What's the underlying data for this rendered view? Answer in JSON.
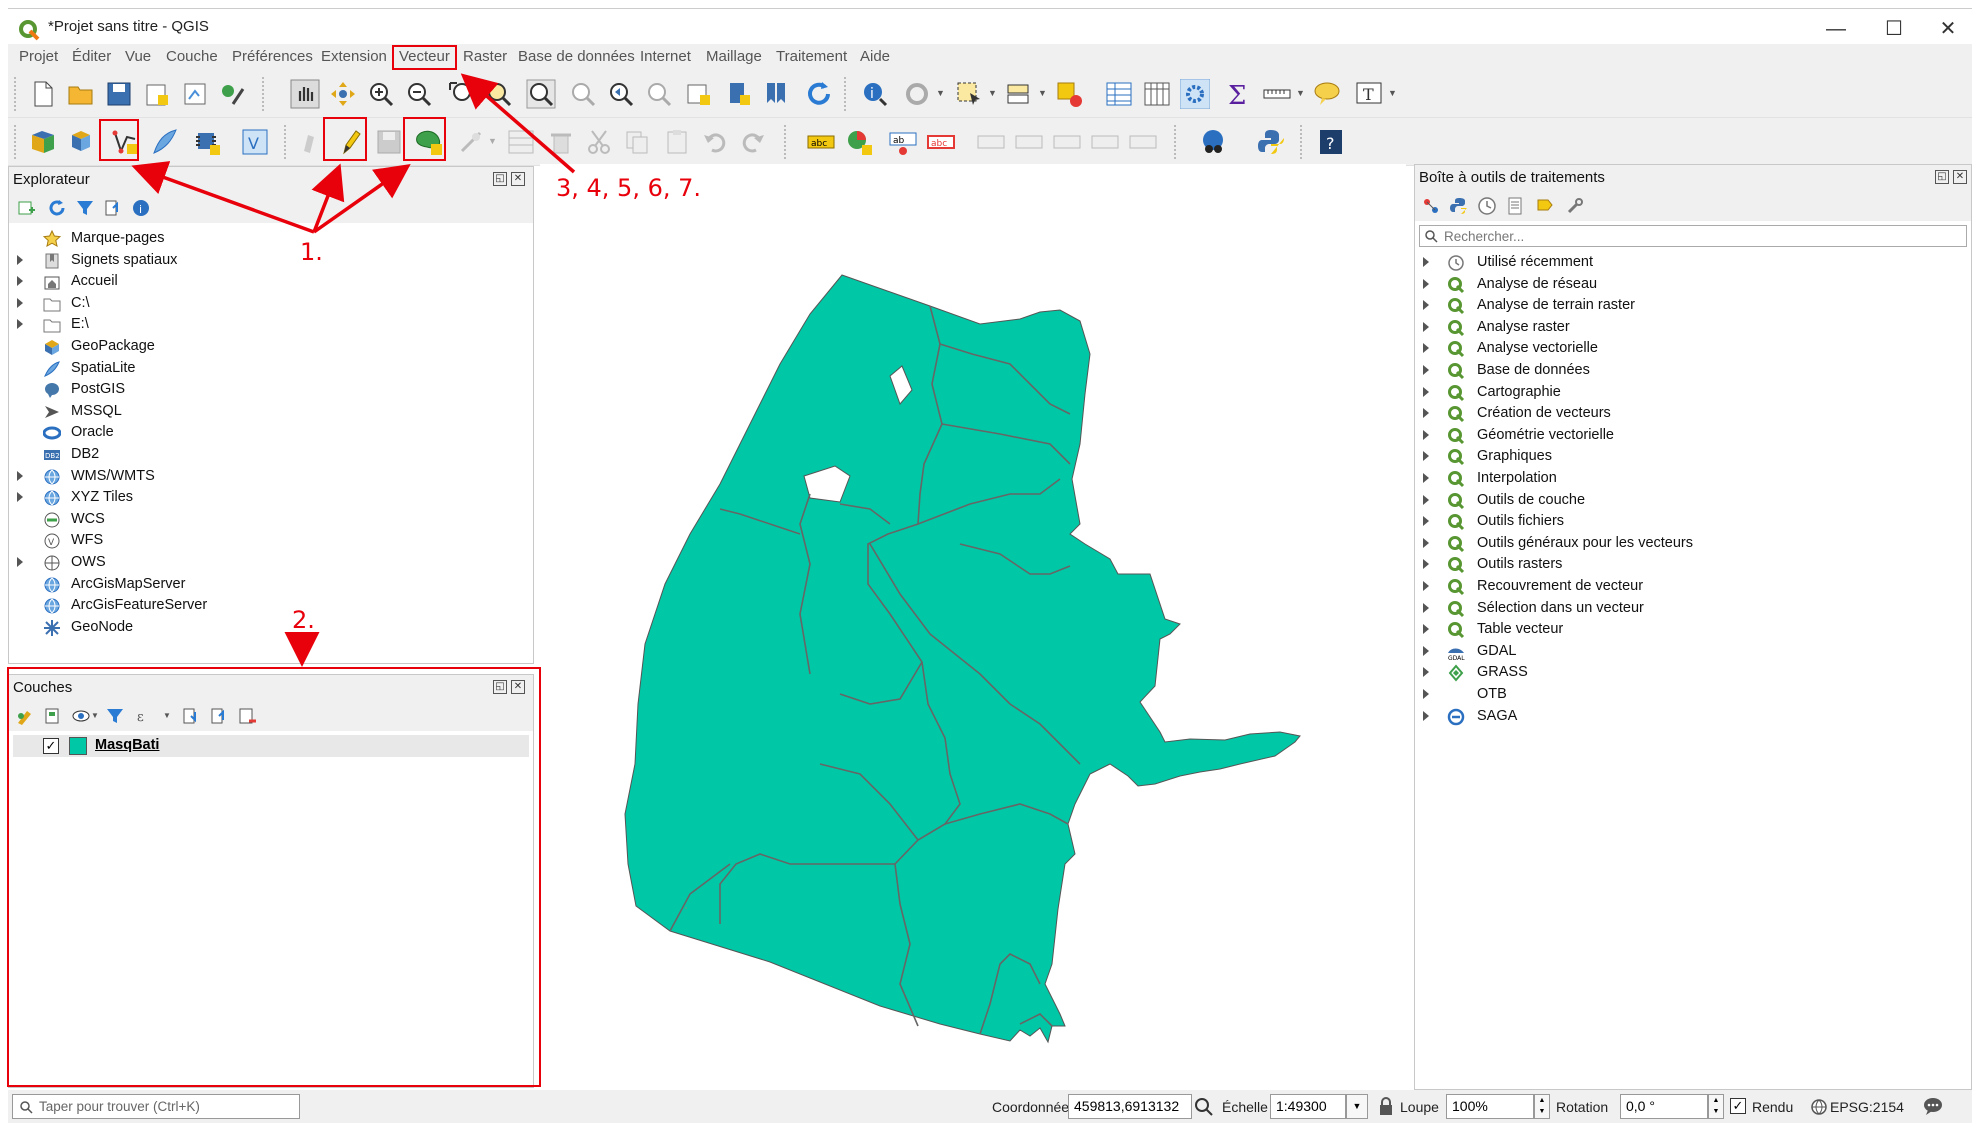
{
  "window": {
    "title": "*Projet sans titre - QGIS",
    "minimize": "—",
    "maximize": "☐",
    "close": "✕"
  },
  "menu": [
    "Projet",
    "Éditer",
    "Vue",
    "Couche",
    "Préférences",
    "Extension",
    "Vecteur",
    "Raster",
    "Base de données",
    "Internet",
    "Maillage",
    "Traitement",
    "Aide"
  ],
  "explorer": {
    "title": "Explorateur",
    "items": [
      {
        "label": "Marque-pages",
        "icon": "star-icon"
      },
      {
        "label": "Signets spatiaux",
        "icon": "spatial-bookmark-icon"
      },
      {
        "label": "Accueil",
        "icon": "home-folder-icon"
      },
      {
        "label": "C:\\",
        "icon": "folder-icon"
      },
      {
        "label": "E:\\",
        "icon": "folder-icon"
      },
      {
        "label": "GeoPackage",
        "icon": "geopackage-icon"
      },
      {
        "label": "SpatiaLite",
        "icon": "spatialite-icon"
      },
      {
        "label": "PostGIS",
        "icon": "postgis-icon"
      },
      {
        "label": "MSSQL",
        "icon": "mssql-icon"
      },
      {
        "label": "Oracle",
        "icon": "oracle-icon"
      },
      {
        "label": "DB2",
        "icon": "db2-icon"
      },
      {
        "label": "WMS/WMTS",
        "icon": "globe-icon"
      },
      {
        "label": "XYZ Tiles",
        "icon": "globe-icon"
      },
      {
        "label": "WCS",
        "icon": "wcs-icon"
      },
      {
        "label": "WFS",
        "icon": "wfs-icon"
      },
      {
        "label": "OWS",
        "icon": "ows-icon"
      },
      {
        "label": "ArcGisMapServer",
        "icon": "globe-icon"
      },
      {
        "label": "ArcGisFeatureServer",
        "icon": "globe-icon"
      },
      {
        "label": "GeoNode",
        "icon": "geonode-icon"
      }
    ]
  },
  "layers": {
    "title": "Couches",
    "items": [
      {
        "label": "MasqBati",
        "checked": "✓",
        "color": "#00c8a6"
      }
    ]
  },
  "processing": {
    "title": "Boîte à outils de traitements",
    "search_placeholder": "Rechercher...",
    "items": [
      {
        "label": "Utilisé récemment",
        "icon": "clock-icon"
      },
      {
        "label": "Analyse de réseau",
        "icon": "qgis-icon"
      },
      {
        "label": "Analyse de terrain raster",
        "icon": "qgis-icon"
      },
      {
        "label": "Analyse raster",
        "icon": "qgis-icon"
      },
      {
        "label": "Analyse vectorielle",
        "icon": "qgis-icon"
      },
      {
        "label": "Base de données",
        "icon": "qgis-icon"
      },
      {
        "label": "Cartographie",
        "icon": "qgis-icon"
      },
      {
        "label": "Création de vecteurs",
        "icon": "qgis-icon"
      },
      {
        "label": "Géométrie vectorielle",
        "icon": "qgis-icon"
      },
      {
        "label": "Graphiques",
        "icon": "qgis-icon"
      },
      {
        "label": "Interpolation",
        "icon": "qgis-icon"
      },
      {
        "label": "Outils de couche",
        "icon": "qgis-icon"
      },
      {
        "label": "Outils fichiers",
        "icon": "qgis-icon"
      },
      {
        "label": "Outils généraux pour les vecteurs",
        "icon": "qgis-icon"
      },
      {
        "label": "Outils rasters",
        "icon": "qgis-icon"
      },
      {
        "label": "Recouvrement de vecteur",
        "icon": "qgis-icon"
      },
      {
        "label": "Sélection dans un vecteur",
        "icon": "qgis-icon"
      },
      {
        "label": "Table vecteur",
        "icon": "qgis-icon"
      },
      {
        "label": "GDAL",
        "icon": "gdal-icon"
      },
      {
        "label": "GRASS",
        "icon": "grass-icon"
      },
      {
        "label": "OTB",
        "icon": ""
      },
      {
        "label": "SAGA",
        "icon": "saga-icon"
      }
    ]
  },
  "status": {
    "locator_placeholder": "Taper pour trouver (Ctrl+K)",
    "coord_label": "Coordonnée",
    "coord_value": "459813,6913132",
    "scale_label": "Échelle",
    "scale_value": "1:49300",
    "magnifier_label": "Loupe",
    "magnifier_value": "100%",
    "rotation_label": "Rotation",
    "rotation_value": "0,0 °",
    "render_label": "Rendu",
    "render_checked": "✓",
    "crs": "EPSG:2154"
  },
  "annotations": {
    "a1": "1.",
    "a2": "2.",
    "a3": "3, 4, 5, 6, 7."
  },
  "colors": {
    "polygon_fill": "#00c8a6",
    "annotation": "#e8000b"
  }
}
